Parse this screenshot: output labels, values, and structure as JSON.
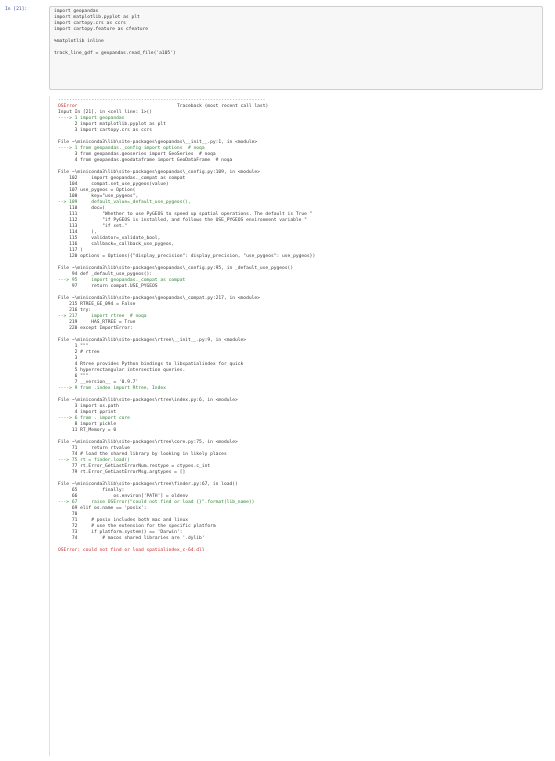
{
  "cell": {
    "prompt": "In [21]:",
    "code_lines": [
      "import geopandas",
      "import matplotlib.pyplot as plt",
      "import cartopy.crs as ccrs",
      "import cartopy.feature as cfeature",
      "",
      "%matplotlib inline",
      "",
      "track_line_gdf = geopandas.read_file('a105')"
    ]
  },
  "traceback": {
    "separator": "---------------------------------------------------------------------------",
    "error_name": "OSError",
    "header": "Traceback (most recent call last)",
    "input_ref": "Input In [21], in <cell line: 1>()",
    "frames": [
      {
        "lines": [
          "----> 1 import geopandas",
          "      2 import matplotlib.pyplot as plt",
          "      3 import cartopy.crs as ccrs"
        ]
      },
      {
        "file": "File ~\\miniconda3\\lib\\site-packages\\geopandas\\__init__.py:1, in <module>",
        "lines": [
          "----> 1 from geopandas._config import options  # noqa",
          "      3 from geopandas.geoseries import GeoSeries  # noqa",
          "      4 from geopandas.geodataframe import GeoDataFrame  # noqa"
        ]
      },
      {
        "file": "File ~\\miniconda3\\lib\\site-packages\\geopandas\\_config.py:109, in <module>",
        "lines": [
          "    102     import geopandas._compat as compat",
          "    104     compat.set_use_pygeos(value)",
          "    107 use_pygeos = Option(",
          "    108     key=\"use_pygeos\",",
          "--> 109     default_value=_default_use_pygeos(),",
          "    110     doc=(",
          "    111         \"Whether to use PyGEOS to speed up spatial operations. The default is True \"",
          "    112         \"if PyGEOS is installed, and follows the USE_PYGEOS environment variable \"",
          "    113         \"if set.\"",
          "    114     ),",
          "    115     validator=_validate_bool,",
          "    116     callback=_callback_use_pygeos,",
          "    117 )",
          "    120 options = Options({\"display_precision\": display_precision, \"use_pygeos\": use_pygeos})"
        ]
      },
      {
        "file": "File ~\\miniconda3\\lib\\site-packages\\geopandas\\_config.py:95, in _default_use_pygeos()",
        "lines": [
          "     94 def _default_use_pygeos():",
          "---> 95     import geopandas._compat as compat",
          "     97     return compat.USE_PYGEOS"
        ]
      },
      {
        "file": "File ~\\miniconda3\\lib\\site-packages\\geopandas\\_compat.py:217, in <module>",
        "lines": [
          "    215 RTREE_GE_094 = False",
          "    216 try:",
          "--> 217     import rtree  # noqa",
          "    219     HAS_RTREE = True",
          "    220 except ImportError:"
        ]
      },
      {
        "file": "File ~\\miniconda3\\lib\\site-packages\\rtree\\__init__.py:9, in <module>",
        "lines": [
          "      1 \"\"\"",
          "      2 # rtree",
          "      3",
          "      4 Rtree provides Python bindings to libspatialindex for quick",
          "      5 hyperrectangular intersection queries.",
          "      6 \"\"\"",
          "      7 __version__ = '0.9.7'",
          "----> 9 from .index import Rtree, Index"
        ]
      },
      {
        "file": "File ~\\miniconda3\\lib\\site-packages\\rtree\\index.py:6, in <module>",
        "lines": [
          "      3 import os.path",
          "      4 import pprint",
          "----> 6 from . import core",
          "      8 import pickle",
          "     11 RT_Memory = 0"
        ]
      },
      {
        "file": "File ~\\miniconda3\\lib\\site-packages\\rtree\\core.py:75, in <module>",
        "lines": [
          "     71     return rtvalue",
          "     74 # load the shared library by looking in likely places",
          "---> 75 rt = finder.load()",
          "     77 rt.Error_GetLastErrorNum.restype = ctypes.c_int",
          "     79 rt.Error_GetLastErrorMsg.argtypes = []"
        ]
      },
      {
        "file": "File ~\\miniconda3\\lib\\site-packages\\rtree\\finder.py:67, in load()",
        "lines": [
          "     65         finally:",
          "     66             os.environ['PATH'] = oldenv",
          "---> 67     raise OSError(\"could not find or load {}\".format(lib_name))",
          "     69 elif os.name == 'posix':",
          "     70",
          "     71     # posix includes both mac and linux",
          "     72     # use the extension for the specific platform",
          "     73     if platform.system() == 'Darwin':",
          "     74         # macos shared libraries are '.dylib'"
        ]
      }
    ],
    "final_error": "OSError: could not find or load spatialindex_c-64.dll"
  }
}
